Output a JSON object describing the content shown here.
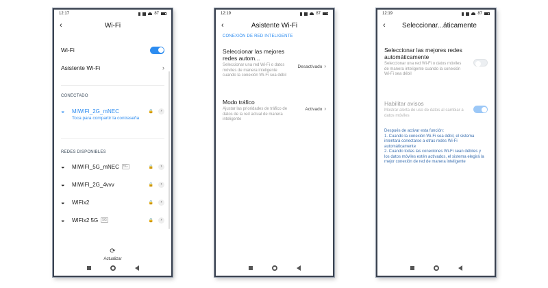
{
  "colors": {
    "accent": "#2d8cf0",
    "frame": "#3a4250"
  },
  "screen1": {
    "status_time": "12:17",
    "status_battery": "87",
    "title": "Wi-Fi",
    "wifi_label": "Wi-Fi",
    "wifi_on": true,
    "assistant_label": "Asistente Wi-Fi",
    "connected_header": "CONECTADO",
    "connected": {
      "name": "MIWIFI_2G_mNEC",
      "sub": "Toca para compartir la contraseña"
    },
    "available_header": "REDES DISPONIBLES",
    "networks": [
      {
        "name": "MIWIFI_5G_mNEC",
        "tag": "5G"
      },
      {
        "name": "MIWIFI_2G_4vvv",
        "tag": ""
      },
      {
        "name": "WIFIx2",
        "tag": ""
      },
      {
        "name": "WIFIx2 5G",
        "tag": "5G"
      }
    ],
    "refresh_label": "Actualizar"
  },
  "screen2": {
    "status_time": "12:19",
    "status_battery": "87",
    "title": "Asistente Wi-Fi",
    "section": "CONEXIÓN DE RED INTELIGENTE",
    "items": [
      {
        "title": "Seleccionar las mejores redes autom...",
        "desc": "Seleccionar una red Wi-Fi o datos móviles de manera inteligente cuando la conexión Wi-Fi sea débil",
        "value": "Desactivado"
      },
      {
        "title": "Modo tráfico",
        "desc": "Ajustar las prioridades de tráfico de datos de la red actual de manera inteligente",
        "value": "Activado"
      }
    ]
  },
  "screen3": {
    "status_time": "12:19",
    "status_battery": "87",
    "title": "Seleccionar...áticamente",
    "item1": {
      "title": "Seleccionar las mejores redes automáticamente",
      "desc": "Seleccionar una red Wi-Fi o datos móviles de manera inteligente cuando la conexión Wi-Fi sea débil",
      "on": false
    },
    "item2": {
      "title": "Habilitar avisos",
      "desc": "Mostrar alerta de uso de datos al cambiar a datos móviles",
      "on": true
    },
    "note": "Después de activar esta función:\n1. Cuando la conexión Wi-Fi sea débil, el sistema intentará conectarse a otras redes Wi-Fi automáticamente\n2. Cuando todas las conexiones Wi-Fi sean débiles y los datos móviles estén activados, el sistema elegirá la mejor conexión de red de manera inteligente"
  }
}
